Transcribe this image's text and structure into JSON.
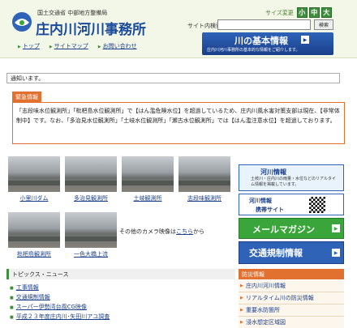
{
  "header": {
    "ministry": "国土交通省 中部地方整備局",
    "office": "庄内川河川事務所",
    "nav": [
      "トップ",
      "サイトマップ",
      "お問い合わせ"
    ],
    "fontsize_label": "サイズ変更",
    "fontsize_buttons": [
      "小",
      "中",
      "大"
    ],
    "search_label": "サイト内検索",
    "search_value": "",
    "search_button": "検索",
    "river_banner_title": "川の基本情報",
    "river_banner_sub": "庄内川河川事務所の基本的な情報をご紹介します。"
  },
  "ticker": "通知います。",
  "emergency": {
    "tab": "緊急情報",
    "text": "「志段味水位観測所」「枇杷島水位観測所」で【はん濫危険水位】を超過しているため、庄内川風水害対策支部は現在、【非常体制中】です。なお、「多治見水位観測所」「土岐水位観測所」「瀬古水位観測所」では【はん濫注意水位】を超過しております。"
  },
  "cameras": [
    {
      "caption": "小里川ダム"
    },
    {
      "caption": "多治見観測所"
    },
    {
      "caption": "土岐観測所"
    },
    {
      "caption": "志段味観測所"
    },
    {
      "caption": "枇杷島観測所"
    },
    {
      "caption": "一色大橋上流"
    }
  ],
  "camera_other": {
    "prefix": "その他のカメラ映像は",
    "link": "こちら",
    "suffix": "から"
  },
  "topics": {
    "header": "トピックス・ニュース",
    "items": [
      "工事情報",
      "交通規制情報",
      "スーパー伊勢湾台風CG映像",
      "平成２３年度庄内川･矢田川アユ調査"
    ]
  },
  "right": {
    "river_info_title": "河川情報",
    "river_info_sub": "土岐川・庄内川の雨量・水位などのリアルタイム情報を掲載しています。",
    "mobile_line1": "河川情報",
    "mobile_line2": "携帯サイト",
    "magazine": "メールマガジン",
    "traffic": "交通規制情報",
    "disaster_header": "防災情報",
    "disaster_items": [
      "庄内川河川情報",
      "リアルタイム川の防災情報",
      "重要水防箇所",
      "浸水想定区域図"
    ]
  },
  "colors": {
    "accent_green": "#3f8f3f",
    "brand_blue": "#2e63b8",
    "emergency_orange": "#e2702f"
  }
}
